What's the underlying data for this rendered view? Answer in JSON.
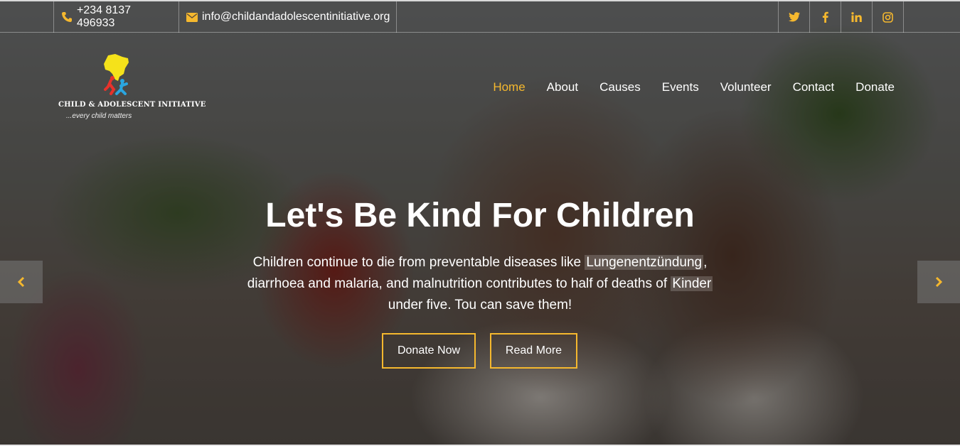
{
  "topbar": {
    "phone": "+234 8137 496933",
    "email": "info@childandadolescentinitiative.org",
    "phone_icon": "phone-icon",
    "email_icon": "envelope-icon",
    "socials": [
      {
        "name": "twitter-icon",
        "glyph": "🐦"
      },
      {
        "name": "facebook-icon",
        "glyph": "f"
      },
      {
        "name": "linkedin-icon",
        "glyph": "in"
      },
      {
        "name": "instagram-icon",
        "glyph": "◎"
      }
    ]
  },
  "logo": {
    "name": "CHILD & ADOLESCENT INITIATIVE",
    "tagline": "...every child matters",
    "colors": {
      "africa": "#f5e21a",
      "red": "#e8322b",
      "blue": "#2aa6e0"
    }
  },
  "nav": {
    "items": [
      "Home",
      "About",
      "Causes",
      "Events",
      "Volunteer",
      "Contact",
      "Donate"
    ],
    "active": "Home"
  },
  "hero": {
    "title": "Let's Be Kind For Children",
    "text_1": "Children continue to die from preventable diseases like ",
    "highlight_1": "Lungenentzündung",
    "text_2": ", diarrhoea and malaria, and malnutrition contributes to half of deaths of ",
    "highlight_2": "Kinder",
    "text_3": " under five. Tou can save them!",
    "donate_label": "Donate Now",
    "read_label": "Read More"
  },
  "slider": {
    "prev_icon": "chevron-left-icon",
    "next_icon": "chevron-right-icon"
  },
  "colors": {
    "accent": "#f5b82e"
  }
}
